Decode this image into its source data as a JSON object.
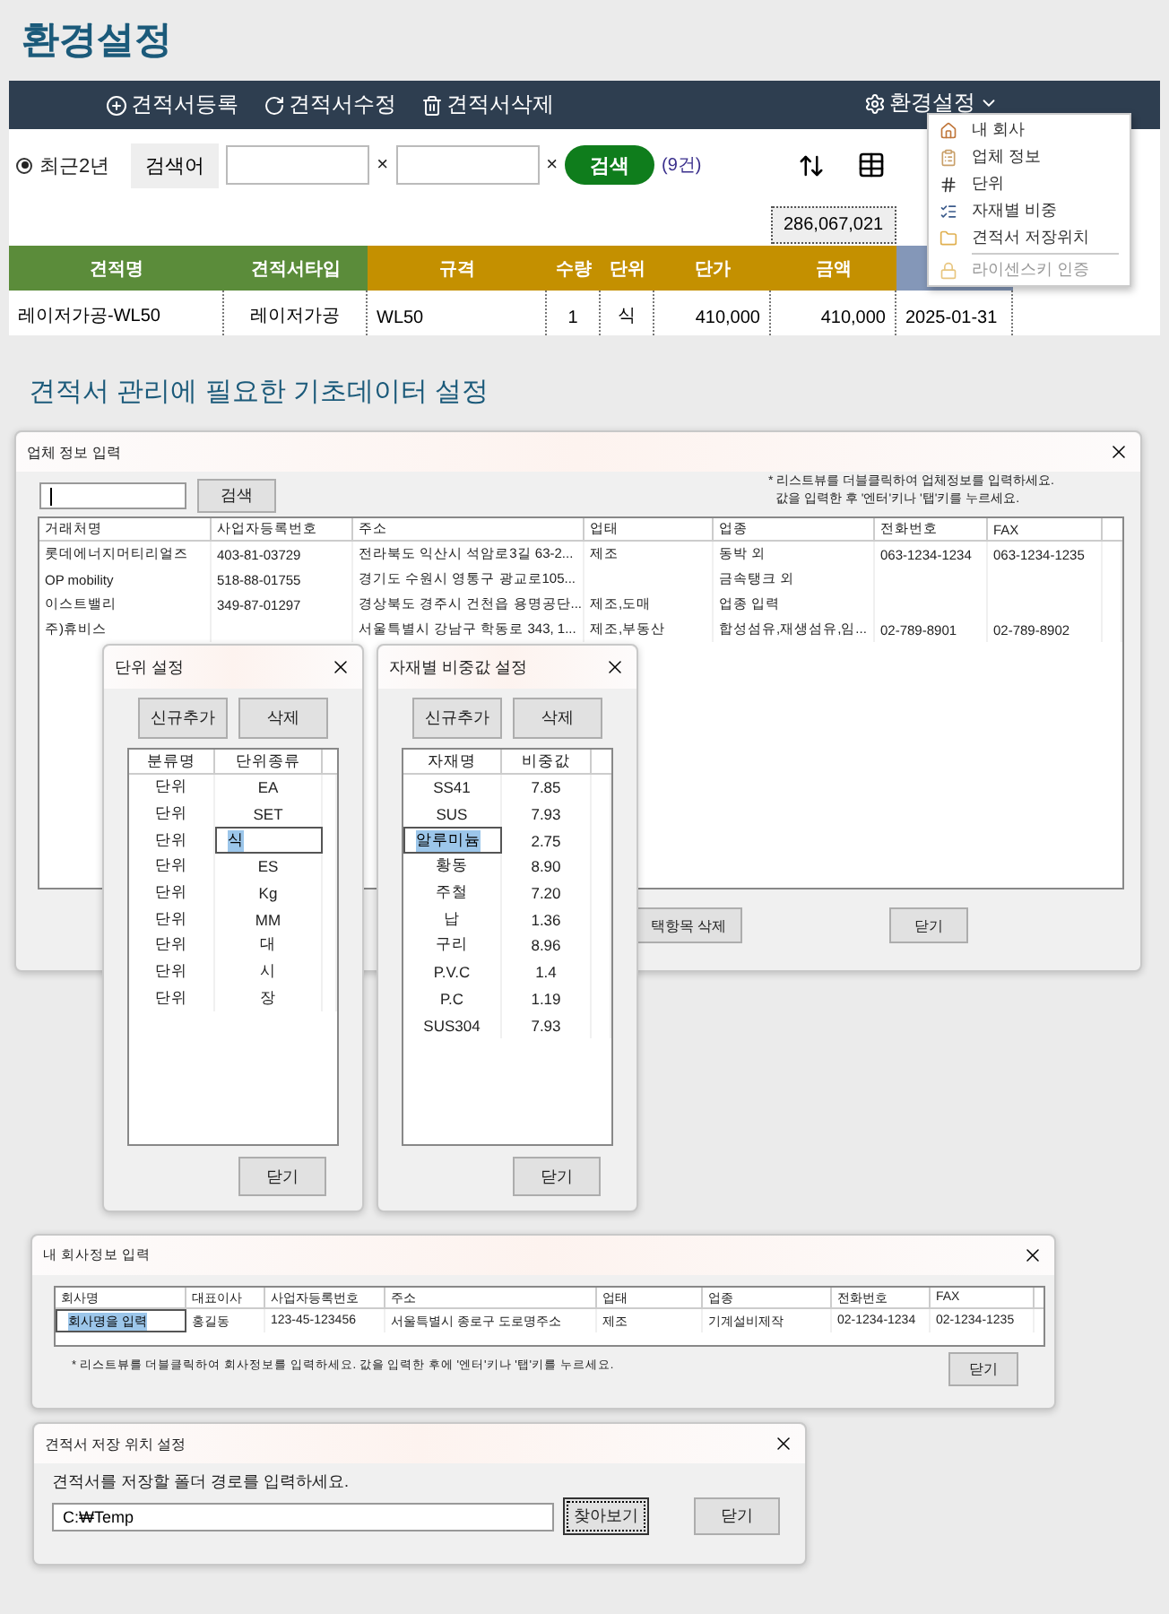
{
  "page_title": "환경설정",
  "toolbar": {
    "buttons": [
      {
        "label": "견적서등록",
        "kind": "add"
      },
      {
        "label": "견적서수정",
        "kind": "edit"
      },
      {
        "label": "견적서삭제",
        "kind": "delete"
      }
    ],
    "settings": "환경설정"
  },
  "menu": {
    "items": [
      {
        "label": "내 회사",
        "kind": "home",
        "disabled": false,
        "separator_before": false
      },
      {
        "label": "업체 정보",
        "kind": "clipboard",
        "disabled": false,
        "separator_before": false
      },
      {
        "label": "단위",
        "kind": "hash",
        "disabled": false,
        "separator_before": false
      },
      {
        "label": "자재별 비중",
        "kind": "list",
        "disabled": false,
        "separator_before": false
      },
      {
        "label": "견적서 저장위치",
        "kind": "folder",
        "disabled": false,
        "separator_before": false
      },
      {
        "label": "라이센스키 인증",
        "kind": "lock",
        "disabled": true,
        "separator_before": true
      }
    ]
  },
  "search": {
    "period": {
      "label": "최근2년",
      "selected": true
    },
    "keyword_label": "검색어",
    "fields": [
      {
        "clear": "×"
      },
      {
        "clear": "×"
      }
    ],
    "button": "검색",
    "count": "(9건)"
  },
  "total": "286,067,021",
  "table": {
    "columns": [
      {
        "label": "견적명",
        "color": "#5b8c3a"
      },
      {
        "label": "견적서타입",
        "color": "#5b8c3a"
      },
      {
        "label": "규격",
        "color": "#c49000"
      },
      {
        "label": "수량",
        "color": "#c49000"
      },
      {
        "label": "단위",
        "color": "#c49000"
      },
      {
        "label": "단가",
        "color": "#c49000"
      },
      {
        "label": "금액",
        "color": "#c49000"
      },
      {
        "color": "#8497b8"
      }
    ],
    "rows": [
      {
        "cells": [
          "레이저가공-WL50",
          "레이저가공",
          "WL50",
          "1",
          "식",
          "410,000",
          "410,000",
          "2025-01-31"
        ]
      }
    ]
  },
  "section_title": "견적서 관리에 필요한 기초데이터 설정",
  "company_window": {
    "title": "업체 정보 입력",
    "search_button": "검색",
    "notes": [
      "* 리스트뷰를 더블클릭하여 업체정보를 입력하세요.",
      "값을 입력한 후 '엔터'키나 '탭'키를 누르세요."
    ],
    "columns": [
      "거래처명",
      "사업자등록번호",
      "주소",
      "업태",
      "업종",
      "전화번호",
      "FAX"
    ],
    "rows": [
      {
        "name": "롯데에너지머티리얼즈",
        "reg_no": "403-81-03729",
        "address": "전라북도 익산시 석암로3길 63-2...",
        "business_type": "제조",
        "industry": "동박 외",
        "phone": "063-1234-1234",
        "fax": "063-1234-1235"
      },
      {
        "name": "OP mobility",
        "reg_no": "518-88-01755",
        "address": "경기도 수원시 영통구 광교로105...",
        "industry": "금속탱크 외"
      },
      {
        "name": "이스트밸리",
        "reg_no": "349-87-01297",
        "address": "경상북도 경주시 건천읍 용명공단...",
        "business_type": "제조,도매",
        "industry": "업종 입력"
      },
      {
        "name": "주)휴비스",
        "address": "서울특별시 강남구 학동로 343, 1...",
        "business_type": "제조,부동산",
        "industry": "합성섬유,재생섬유,임...",
        "phone": "02-789-8901",
        "fax": "02-789-8902"
      }
    ],
    "buttons": [
      "택항목 삭제",
      "닫기"
    ]
  },
  "units_window": {
    "title": "단위 설정",
    "buttons": [
      "신규추가",
      "삭제"
    ],
    "columns": [
      "분류명",
      "단위종류"
    ],
    "rows": [
      {
        "category": "단위",
        "unit": "EA",
        "editing": false
      },
      {
        "category": "단위",
        "unit": "SET",
        "editing": false
      },
      {
        "category": "단위",
        "unit": "식",
        "editing": true
      },
      {
        "category": "단위",
        "unit": "ES",
        "editing": false
      },
      {
        "category": "단위",
        "unit": "Kg",
        "editing": false
      },
      {
        "category": "단위",
        "unit": "MM",
        "editing": false
      },
      {
        "category": "단위",
        "unit": "대",
        "editing": false
      },
      {
        "category": "단위",
        "unit": "시",
        "editing": false
      },
      {
        "category": "단위",
        "unit": "장",
        "editing": false
      }
    ],
    "close_button": "닫기"
  },
  "density_window": {
    "title": "자재별 비중값 설정",
    "buttons": [
      "신규추가",
      "삭제"
    ],
    "columns": [
      "자재명",
      "비중값"
    ],
    "rows": [
      {
        "material": "SS41",
        "density": "7.85",
        "editing": false
      },
      {
        "material": "SUS",
        "density": "7.93",
        "editing": false
      },
      {
        "material": "알루미늄",
        "density": "2.75",
        "editing": true
      },
      {
        "material": "황동",
        "density": "8.90",
        "editing": false
      },
      {
        "material": "주철",
        "density": "7.20",
        "editing": false
      },
      {
        "material": "납",
        "density": "1.36",
        "editing": false
      },
      {
        "material": "구리",
        "density": "8.96",
        "editing": false
      },
      {
        "material": "P.V.C",
        "density": "1.4",
        "editing": false
      },
      {
        "material": "P.C",
        "density": "1.19",
        "editing": false
      },
      {
        "material": "SUS304",
        "density": "7.93",
        "editing": false
      }
    ],
    "close_button": "닫기"
  },
  "my_company_window": {
    "title": "내 회사정보 입력",
    "columns": [
      "회사명",
      "대표이사",
      "사업자등록번호",
      "주소",
      "업태",
      "업종",
      "전화번호",
      "FAX"
    ],
    "rows": [
      {
        "name": "회사명을 입력",
        "ceo": "홍길동",
        "reg_no": "123-45-123456",
        "address": "서울특별시 종로구 도로명주소",
        "business_type": "제조",
        "industry": "기계설비제작",
        "phone": "02-1234-1234",
        "fax": "02-1234-1235",
        "editing": true
      }
    ],
    "note": "* 리스트뷰를 더블클릭하여 회사정보를 입력하세요. 값을 입력한 후에 '엔터'키나 '탭'키를 누르세요.",
    "close_button": "닫기"
  },
  "save_window": {
    "title": "견적서 저장 위치 설정",
    "prompt": "견적서를 저장할 폴더 경로를 입력하세요.",
    "path": "C:₩Temp",
    "browse_button": "찾아보기",
    "browse_focused": true,
    "close_button": "닫기"
  }
}
